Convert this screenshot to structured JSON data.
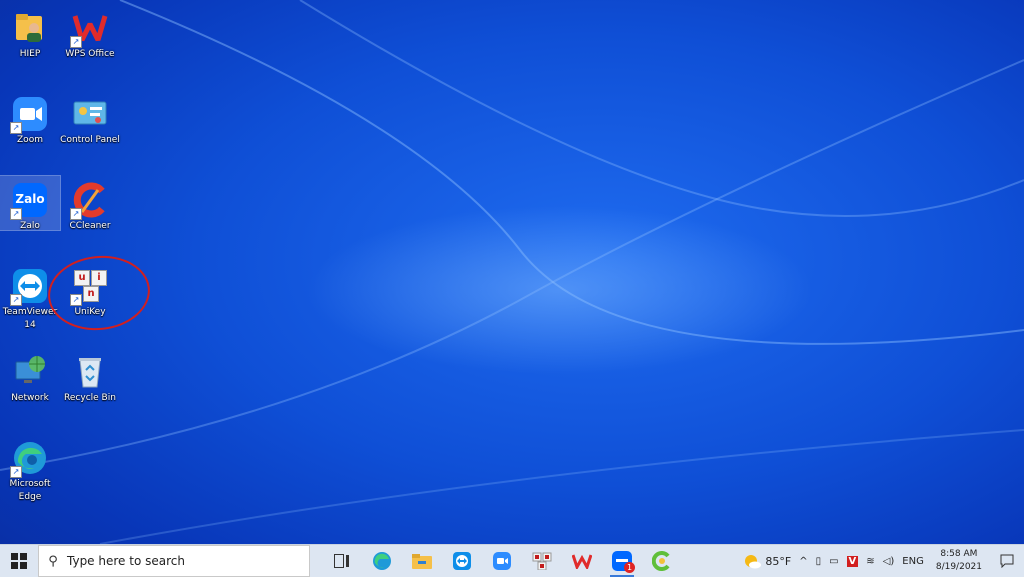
{
  "desktop": {
    "icons": [
      {
        "label": "HIEP"
      },
      {
        "label": "WPS Office"
      },
      {
        "label": "Zoom"
      },
      {
        "label": "Control Panel"
      },
      {
        "label": "Zalo",
        "badge_text": "Zalo"
      },
      {
        "label": "CCleaner"
      },
      {
        "label": "TeamViewer 14"
      },
      {
        "label": "UniKey",
        "letters": [
          "u",
          "i",
          "n"
        ]
      },
      {
        "label": "Network"
      },
      {
        "label": "Recycle Bin"
      },
      {
        "label": "Microsoft Edge"
      }
    ],
    "annotation_color": "#d21f1f"
  },
  "taskbar": {
    "search_placeholder": "Type here to search",
    "zalo_badge": "1",
    "weather": "85°F",
    "language": "ENG",
    "time": "8:58 AM",
    "date": "8/19/2021",
    "accent": "#3a7ad8"
  }
}
